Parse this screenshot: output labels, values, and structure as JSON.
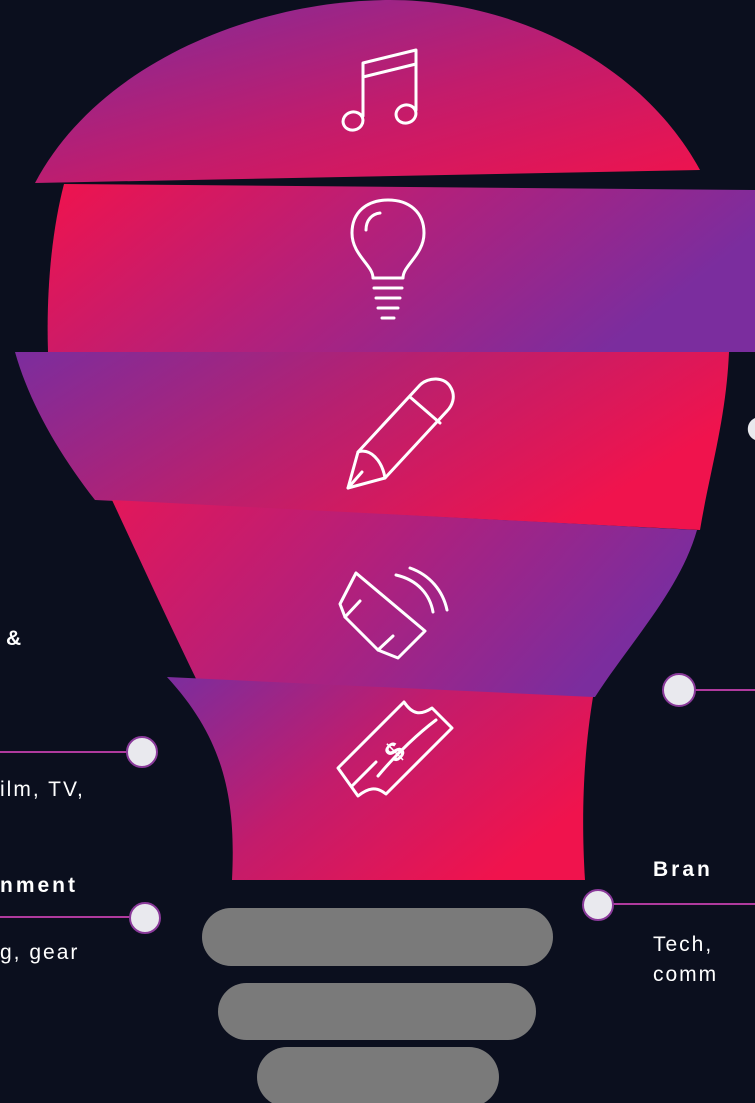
{
  "colors": {
    "background": "#0b0f1e",
    "pink": "#f0134d",
    "purple": "#7b2d9e",
    "base": "#7a7a7a",
    "line": "#b03a9e",
    "dot": "#e9e9ee"
  },
  "bands": [
    {
      "name": "music",
      "icon": "music-note-icon"
    },
    {
      "name": "idea",
      "icon": "lightbulb-icon"
    },
    {
      "name": "writing",
      "icon": "pencil-icon"
    },
    {
      "name": "audio",
      "icon": "speaker-icon"
    },
    {
      "name": "money",
      "icon": "money-bill-icon"
    }
  ],
  "left_labels": {
    "top_title_fragment": "&",
    "top_desc_fragment": "ilm, TV,",
    "bottom_title_fragment": "nment",
    "bottom_desc_fragment": "g, gear"
  },
  "right_labels": {
    "title_fragment": "Bran",
    "desc_line1_fragment": "Tech,",
    "desc_line2_fragment": "comm"
  }
}
